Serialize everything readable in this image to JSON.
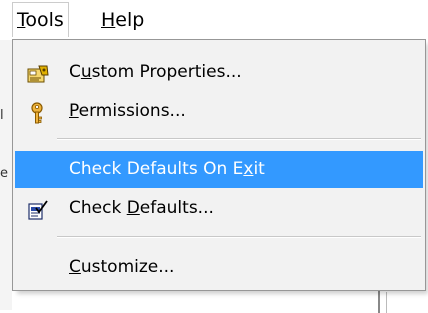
{
  "menubar": {
    "tools": {
      "accel": "T",
      "rest": "ools"
    },
    "help": {
      "accel": "H",
      "rest": "elp"
    }
  },
  "background": {
    "edge_fragment_top": "l",
    "edge_fragment_mid": "e"
  },
  "menu": {
    "items": [
      {
        "pre": "C",
        "accel": "u",
        "post": "stom Properties...",
        "icon": "custom-properties-icon",
        "highlighted": false
      },
      {
        "pre": "",
        "accel": "P",
        "post": "ermissions...",
        "icon": "key-icon",
        "highlighted": false
      },
      {
        "pre": "Check Defaults On E",
        "accel": "x",
        "post": "it",
        "icon": "",
        "highlighted": true
      },
      {
        "pre": "Check ",
        "accel": "D",
        "post": "efaults...",
        "icon": "check-defaults-icon",
        "highlighted": false
      },
      {
        "pre": "",
        "accel": "C",
        "post": "ustomize...",
        "icon": "",
        "highlighted": false
      }
    ]
  },
  "colors": {
    "highlight": "#3399ff",
    "menu_bg": "#f2f2f2",
    "menu_border": "#979797"
  }
}
